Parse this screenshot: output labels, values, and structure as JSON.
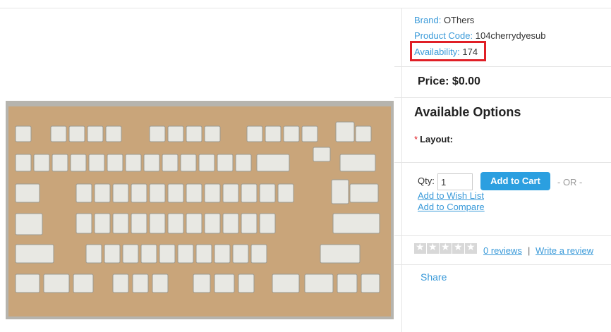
{
  "product": {
    "brand_label": "Brand:",
    "brand_value": "OThers",
    "code_label": "Product Code:",
    "code_value": "104cherrydyesub",
    "availability_label": "Availability:",
    "availability_value": "174",
    "price": "Price: $0.00",
    "image_alt": "keyboard-keycaps-photo"
  },
  "options": {
    "title": "Available Options",
    "required_mark": "*",
    "layout_label": "Layout:"
  },
  "cart": {
    "qty_label": "Qty:",
    "qty_value": "1",
    "add_to_cart": "Add to Cart",
    "or_text": "- OR -",
    "wish_list": "Add to Wish List",
    "compare": "Add to Compare"
  },
  "reviews": {
    "rating_stars": 0,
    "reviews_link": "0 reviews",
    "separator": "|",
    "write_review": "Write a review"
  },
  "share": "Share",
  "colors": {
    "link": "#3a9ad9",
    "button": "#2b9fe0",
    "highlight": "#e01f26"
  }
}
